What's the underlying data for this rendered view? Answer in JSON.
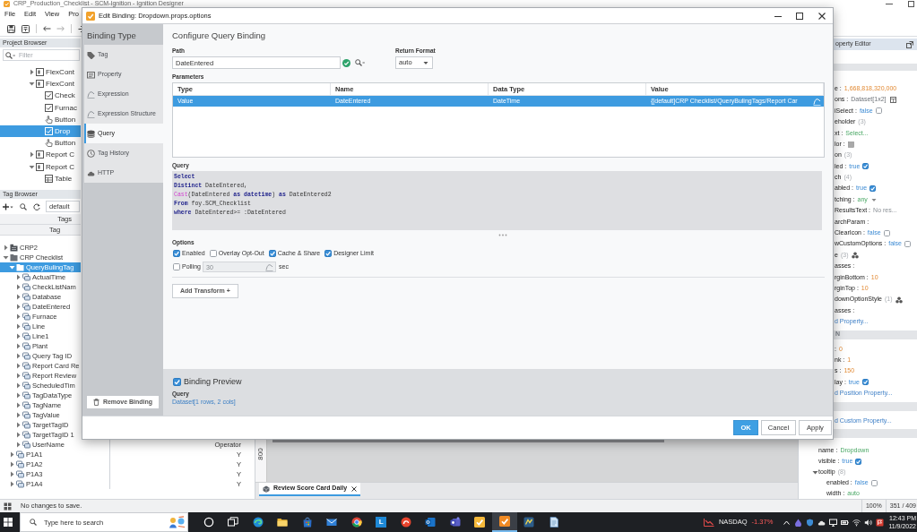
{
  "app": {
    "title": "CRP_Production_Checklist - SCM-Ignition - Ignition Designer",
    "menu": [
      "File",
      "Edit",
      "View",
      "Pro"
    ]
  },
  "project_browser": {
    "title": "Project Browser",
    "filter": {
      "placeholder": "Filter"
    },
    "tree": [
      {
        "label": "FlexCont",
        "kind": "container",
        "expanded": false,
        "selected": false
      },
      {
        "label": "FlexCont",
        "kind": "container",
        "expanded": true,
        "selected": false,
        "children": [
          {
            "label": "Check",
            "kind": "component",
            "selected": false
          },
          {
            "label": "Furnac",
            "kind": "component",
            "selected": false
          },
          {
            "label": "Button",
            "kind": "button",
            "selected": false
          },
          {
            "label": "Drop",
            "kind": "component",
            "selected": true
          },
          {
            "label": "Button",
            "kind": "button",
            "selected": false
          }
        ]
      },
      {
        "label": "Report C",
        "kind": "container",
        "expanded": false,
        "selected": false
      },
      {
        "label": "Report C",
        "kind": "container",
        "expanded": true,
        "selected": false,
        "children": [
          {
            "label": "Table",
            "kind": "table",
            "selected": false
          }
        ]
      }
    ]
  },
  "tag_browser": {
    "title": "Tag Browser",
    "provider": "default",
    "header": "Tags",
    "column_1": "Tag",
    "tree": [
      {
        "label": "CRP2",
        "kind": "provider",
        "expanded": false,
        "selected": false
      },
      {
        "label": "CRP Checklist",
        "kind": "folder",
        "expanded": true,
        "selected": false,
        "children": [
          {
            "label": "QueryBulingTag",
            "kind": "folder",
            "expanded": true,
            "selected": true,
            "children": [
              {
                "label": "ActualTime",
                "kind": "tag",
                "expanded": false,
                "selected": false
              },
              {
                "label": "CheckListNam",
                "kind": "tag",
                "expanded": false,
                "selected": false
              },
              {
                "label": "Database",
                "kind": "tag",
                "expanded": false,
                "selected": false
              },
              {
                "label": "DateEntered",
                "kind": "tag",
                "expanded": false,
                "selected": false
              },
              {
                "label": "Furnace",
                "kind": "tag",
                "expanded": false,
                "selected": false
              },
              {
                "label": "Line",
                "kind": "tag",
                "expanded": false,
                "selected": false
              },
              {
                "label": "Line1",
                "kind": "tag",
                "expanded": false,
                "selected": false
              },
              {
                "label": "Plant",
                "kind": "tag",
                "expanded": false,
                "selected": false
              },
              {
                "label": "Query Tag ID",
                "kind": "tag",
                "expanded": false,
                "selected": false
              },
              {
                "label": "Report Card Re",
                "kind": "tag",
                "expanded": false,
                "selected": false
              },
              {
                "label": "Report Review",
                "kind": "tag",
                "expanded": false,
                "selected": false
              },
              {
                "label": "ScheduledTim",
                "kind": "tag",
                "expanded": false,
                "selected": false
              },
              {
                "label": "TagDataType",
                "kind": "tag",
                "expanded": false,
                "selected": false
              },
              {
                "label": "TagName",
                "kind": "tag",
                "expanded": false,
                "selected": false
              },
              {
                "label": "TagValue",
                "kind": "tag",
                "expanded": false,
                "selected": false
              },
              {
                "label": "TargetTagID",
                "kind": "tag",
                "expanded": false,
                "selected": false
              },
              {
                "label": "TargetTagID 1",
                "kind": "tag",
                "expanded": false,
                "selected": false
              },
              {
                "label": "UserName",
                "kind": "tag",
                "expanded": false,
                "selected": false,
                "value": "Operator"
              }
            ]
          },
          {
            "label": "P1A1",
            "kind": "tag",
            "expanded": false,
            "selected": false,
            "value": "Y"
          },
          {
            "label": "P1A2",
            "kind": "tag",
            "expanded": false,
            "selected": false,
            "value": "Y"
          },
          {
            "label": "P1A3",
            "kind": "tag",
            "expanded": false,
            "selected": false,
            "value": "Y"
          },
          {
            "label": "P1A4",
            "kind": "tag",
            "expanded": false,
            "selected": false,
            "value": "Y"
          }
        ]
      }
    ]
  },
  "designer": {
    "ruler_label": "800",
    "tabs": [
      {
        "label": "Review Score Card Daily",
        "selected": true
      }
    ]
  },
  "property_editor": {
    "title": "operty Editor",
    "sections": [
      {
        "rows": [
          {
            "kind": "number",
            "name": "e :",
            "value": "1,668,818,320,000"
          },
          {
            "kind": "dataset",
            "name": "ons :",
            "value": "Dataset[1x2]"
          },
          {
            "kind": "boolean",
            "name": "iSelect :",
            "value": "false",
            "checked": false
          },
          {
            "kind": "object",
            "name": "eholder",
            "count": "(3)"
          },
          {
            "kind": "string",
            "name": "xt :",
            "value": "Select..."
          },
          {
            "kind": "color",
            "name": "lor :"
          },
          {
            "kind": "object",
            "name": "on",
            "count": "(3)"
          },
          {
            "kind": "boolean",
            "name": "led :",
            "value": "true",
            "checked": true
          },
          {
            "kind": "object",
            "name": "ch",
            "count": "(4)"
          },
          {
            "kind": "boolean",
            "name": "abled :",
            "value": "true",
            "checked": true
          },
          {
            "kind": "enum",
            "name": "tching :",
            "value": "any"
          },
          {
            "kind": "text",
            "name": "ResultsText :",
            "value": "No res..."
          },
          {
            "kind": "empty",
            "name": "archParam :"
          },
          {
            "kind": "boolean",
            "name": "ClearIcon :",
            "value": "false",
            "checked": false
          },
          {
            "kind": "boolean",
            "name": "wCustomOptions :",
            "value": "false",
            "checked": false
          },
          {
            "kind": "styled-object",
            "name": "e",
            "count": "(3)"
          },
          {
            "kind": "empty",
            "name": "asses :"
          },
          {
            "kind": "number",
            "name": "rginBottom :",
            "value": "10"
          },
          {
            "kind": "number",
            "name": "rginTop :",
            "value": "10"
          },
          {
            "kind": "styled-object",
            "name": "downOptionStyle",
            "count": "(1)"
          },
          {
            "kind": "empty",
            "name": "asses :"
          },
          {
            "kind": "link",
            "label": "d Property..."
          }
        ]
      },
      {
        "header": "N",
        "rows": [
          {
            "kind": "number",
            "name": ":",
            "value": "0"
          },
          {
            "kind": "number",
            "name": "nk :",
            "value": "1"
          },
          {
            "kind": "number",
            "name": "s :",
            "value": "150"
          },
          {
            "kind": "boolean",
            "name": "lay :",
            "value": "true",
            "checked": true
          },
          {
            "kind": "link",
            "label": "d Position Property..."
          }
        ]
      },
      {
        "rows": [
          {
            "kind": "link",
            "label": "d Custom Property..."
          }
        ]
      },
      {
        "rows": [
          {
            "kind": "string",
            "name": "name :",
            "value": "Dropdown"
          },
          {
            "kind": "boolean",
            "name": "visible :",
            "value": "true",
            "checked": true
          },
          {
            "kind": "object",
            "name": "tooltip",
            "count": "(8)",
            "expanded": true,
            "children": [
              {
                "kind": "boolean",
                "name": "enabled :",
                "value": "false",
                "checked": false
              },
              {
                "kind": "string",
                "name": "width :",
                "value": "auto"
              }
            ]
          }
        ]
      }
    ]
  },
  "status_bar": {
    "message": "No changes to save.",
    "zoom": "100%",
    "position": "351 / 409"
  },
  "taskbar": {
    "search_placeholder": "Type here to search",
    "apps": [
      {
        "kind": "ring",
        "active": false
      },
      {
        "kind": "task-view",
        "active": false
      },
      {
        "kind": "swirl",
        "active": false
      },
      {
        "kind": "folder",
        "active": false
      },
      {
        "kind": "bag",
        "active": false
      },
      {
        "kind": "mail",
        "active": false
      },
      {
        "kind": "tricolor",
        "active": false
      },
      {
        "kind": "letter",
        "label": "L",
        "active": false
      },
      {
        "kind": "badge",
        "active": false
      },
      {
        "kind": "mail-tile",
        "active": false
      },
      {
        "kind": "people-tile",
        "active": false
      },
      {
        "kind": "check-tile",
        "active": false
      },
      {
        "kind": "check-tile-orange",
        "active": true
      },
      {
        "kind": "chart-tile",
        "active": false
      },
      {
        "kind": "document",
        "active": false
      }
    ],
    "ticker": {
      "name": "NASDAQ",
      "change": "-1.37%"
    },
    "clock": {
      "time": "12:43 PM",
      "date": "11/9/2022"
    }
  },
  "dialog": {
    "title": "Edit Binding: Dropdown.props.options",
    "sidebar": {
      "title": "Binding Type",
      "items": [
        {
          "label": "Tag",
          "kind": "tag",
          "selected": false
        },
        {
          "label": "Property",
          "kind": "property",
          "selected": false
        },
        {
          "label": "Expression",
          "kind": "expression",
          "selected": false
        },
        {
          "label": "Expression Structure",
          "kind": "expression",
          "selected": false
        },
        {
          "label": "Query",
          "kind": "query",
          "selected": true
        },
        {
          "label": "Tag History",
          "kind": "history",
          "selected": false
        },
        {
          "label": "HTTP",
          "kind": "http",
          "selected": false
        }
      ],
      "remove_button": "Remove Binding"
    },
    "heading": "Configure Query Binding",
    "path": {
      "label": "Path",
      "value": "DateEntered",
      "valid": true
    },
    "return_format": {
      "label": "Return Format",
      "value": "auto"
    },
    "parameters": {
      "label": "Parameters",
      "columns": [
        "Type",
        "Name",
        "Data Type",
        "Value"
      ],
      "rows": [
        {
          "cells": [
            "Value",
            "DateEntered",
            "DateTime",
            "{[default]CRP Checklist/QueryBulingTags/Report Car"
          ],
          "selected": true
        }
      ]
    },
    "query": {
      "label": "Query",
      "lines": [
        [
          {
            "text": "Select",
            "kind": "keyword"
          }
        ],
        [
          {
            "text": "Distinct",
            "kind": "keyword"
          },
          {
            "text": " DateEntered,",
            "kind": "plain"
          }
        ],
        [
          {
            "text": "Cast",
            "kind": "function"
          },
          {
            "text": "(DateEntered ",
            "kind": "plain"
          },
          {
            "text": "as datetime",
            "kind": "keyword"
          },
          {
            "text": ") ",
            "kind": "plain"
          },
          {
            "text": "as",
            "kind": "keyword"
          },
          {
            "text": " DateEntered2",
            "kind": "plain"
          }
        ],
        [
          {
            "text": "From",
            "kind": "keyword"
          },
          {
            "text": " foy.SCM_Checklist",
            "kind": "plain"
          }
        ],
        [
          {
            "text": "where",
            "kind": "keyword"
          },
          {
            "text": " DateEntered>= :DateEntered",
            "kind": "plain"
          }
        ]
      ]
    },
    "options": {
      "label": "Options",
      "checkboxes": [
        {
          "label": "Enabled",
          "checked": true
        },
        {
          "label": "Overlay Opt-Out",
          "checked": false
        },
        {
          "label": "Cache & Share",
          "checked": true
        },
        {
          "label": "Designer Limit",
          "checked": true
        }
      ],
      "polling": {
        "label": "Polling",
        "checked": false,
        "value": "30",
        "unit": "sec"
      }
    },
    "add_transform": "Add Transform +",
    "preview": {
      "label": "Binding Preview",
      "checked": true,
      "type": "Query",
      "result": "Dataset[1 rows, 2 cols]"
    },
    "buttons": [
      {
        "label": "OK",
        "kind": "confirm"
      },
      {
        "label": "Cancel",
        "kind": "cancel"
      },
      {
        "label": "Apply",
        "kind": "apply"
      }
    ]
  }
}
